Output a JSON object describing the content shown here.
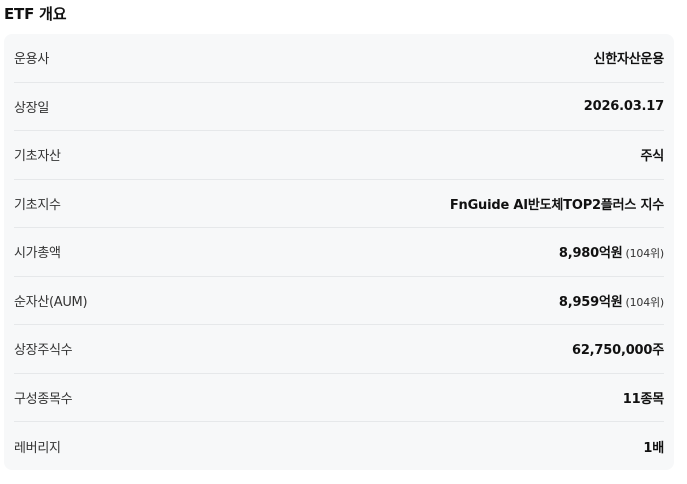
{
  "section": {
    "title": "ETF 개요"
  },
  "rows": [
    {
      "label": "운용사",
      "value": "신한자산운용",
      "rank": ""
    },
    {
      "label": "상장일",
      "value": "2026.03.17",
      "rank": ""
    },
    {
      "label": "기초자산",
      "value": "주식",
      "rank": ""
    },
    {
      "label": "기초지수",
      "value": "FnGuide AI반도체TOP2플러스 지수",
      "rank": ""
    },
    {
      "label": "시가총액",
      "value": "8,980억원",
      "rank": "(104위)"
    },
    {
      "label": "순자산(AUM)",
      "value": "8,959억원",
      "rank": "(104위)"
    },
    {
      "label": "상장주식수",
      "value": "62,750,000주",
      "rank": ""
    },
    {
      "label": "구성종목수",
      "value": "11종목",
      "rank": ""
    },
    {
      "label": "레버리지",
      "value": "1배",
      "rank": ""
    }
  ]
}
